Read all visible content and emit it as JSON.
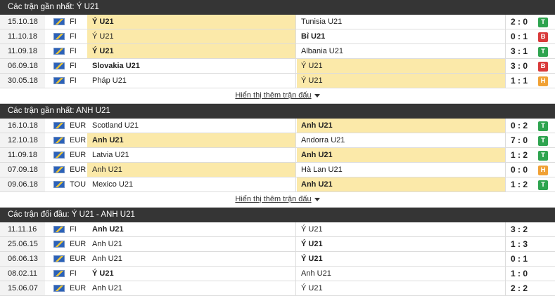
{
  "colors": {
    "win": "#2ea44f",
    "loss": "#d93a3a",
    "draw": "#f0a135",
    "header_bg": "#353535",
    "highlight": "#fbe9a9"
  },
  "sections": [
    {
      "title": "Các trận gần nhất: Ý U21",
      "show_more": "Hiển thị thêm trận đấu",
      "rows": [
        {
          "date": "15.10.18",
          "league": "FI",
          "home": "Ý U21",
          "away": "Tunisia U21",
          "score": "2 : 0",
          "result": "T",
          "bold": "home",
          "highlight": "home"
        },
        {
          "date": "11.10.18",
          "league": "FI",
          "home": "Ý U21",
          "away": "Bỉ U21",
          "score": "0 : 1",
          "result": "B",
          "bold": "away",
          "highlight": "home"
        },
        {
          "date": "11.09.18",
          "league": "FI",
          "home": "Ý U21",
          "away": "Albania U21",
          "score": "3 : 1",
          "result": "T",
          "bold": "home",
          "highlight": "home"
        },
        {
          "date": "06.09.18",
          "league": "FI",
          "home": "Slovakia U21",
          "away": "Ý U21",
          "score": "3 : 0",
          "result": "B",
          "bold": "home",
          "highlight": "away"
        },
        {
          "date": "30.05.18",
          "league": "FI",
          "home": "Pháp U21",
          "away": "Ý U21",
          "score": "1 : 1",
          "result": "H",
          "bold": "none",
          "highlight": "away"
        }
      ]
    },
    {
      "title": "Các trận gần nhất: ANH U21",
      "show_more": "Hiển thị thêm trận đấu",
      "rows": [
        {
          "date": "16.10.18",
          "league": "EUR",
          "home": "Scotland U21",
          "away": "Anh U21",
          "score": "0 : 2",
          "result": "T",
          "bold": "away",
          "highlight": "away"
        },
        {
          "date": "12.10.18",
          "league": "EUR",
          "home": "Anh U21",
          "away": "Andorra U21",
          "score": "7 : 0",
          "result": "T",
          "bold": "home",
          "highlight": "home"
        },
        {
          "date": "11.09.18",
          "league": "EUR",
          "home": "Latvia U21",
          "away": "Anh U21",
          "score": "1 : 2",
          "result": "T",
          "bold": "away",
          "highlight": "away"
        },
        {
          "date": "07.09.18",
          "league": "EUR",
          "home": "Anh U21",
          "away": "Hà Lan U21",
          "score": "0 : 0",
          "result": "H",
          "bold": "none",
          "highlight": "home"
        },
        {
          "date": "09.06.18",
          "league": "TOU",
          "home": "Mexico U21",
          "away": "Anh U21",
          "score": "1 : 2",
          "result": "T",
          "bold": "away",
          "highlight": "away"
        }
      ]
    },
    {
      "title": "Các trận đối đầu: Ý U21 - ANH U21",
      "show_more": "",
      "rows": [
        {
          "date": "11.11.16",
          "league": "FI",
          "home": "Anh U21",
          "away": "Ý U21",
          "score": "3 : 2",
          "result": "",
          "bold": "home",
          "highlight": "none"
        },
        {
          "date": "25.06.15",
          "league": "EUR",
          "home": "Anh U21",
          "away": "Ý U21",
          "score": "1 : 3",
          "result": "",
          "bold": "away",
          "highlight": "none"
        },
        {
          "date": "06.06.13",
          "league": "EUR",
          "home": "Anh U21",
          "away": "Ý U21",
          "score": "0 : 1",
          "result": "",
          "bold": "away",
          "highlight": "none"
        },
        {
          "date": "08.02.11",
          "league": "FI",
          "home": "Ý U21",
          "away": "Anh U21",
          "score": "1 : 0",
          "result": "",
          "bold": "home",
          "highlight": "none"
        },
        {
          "date": "15.06.07",
          "league": "EUR",
          "home": "Anh U21",
          "away": "Ý U21",
          "score": "2 : 2",
          "result": "",
          "bold": "none",
          "highlight": "none"
        }
      ]
    }
  ]
}
